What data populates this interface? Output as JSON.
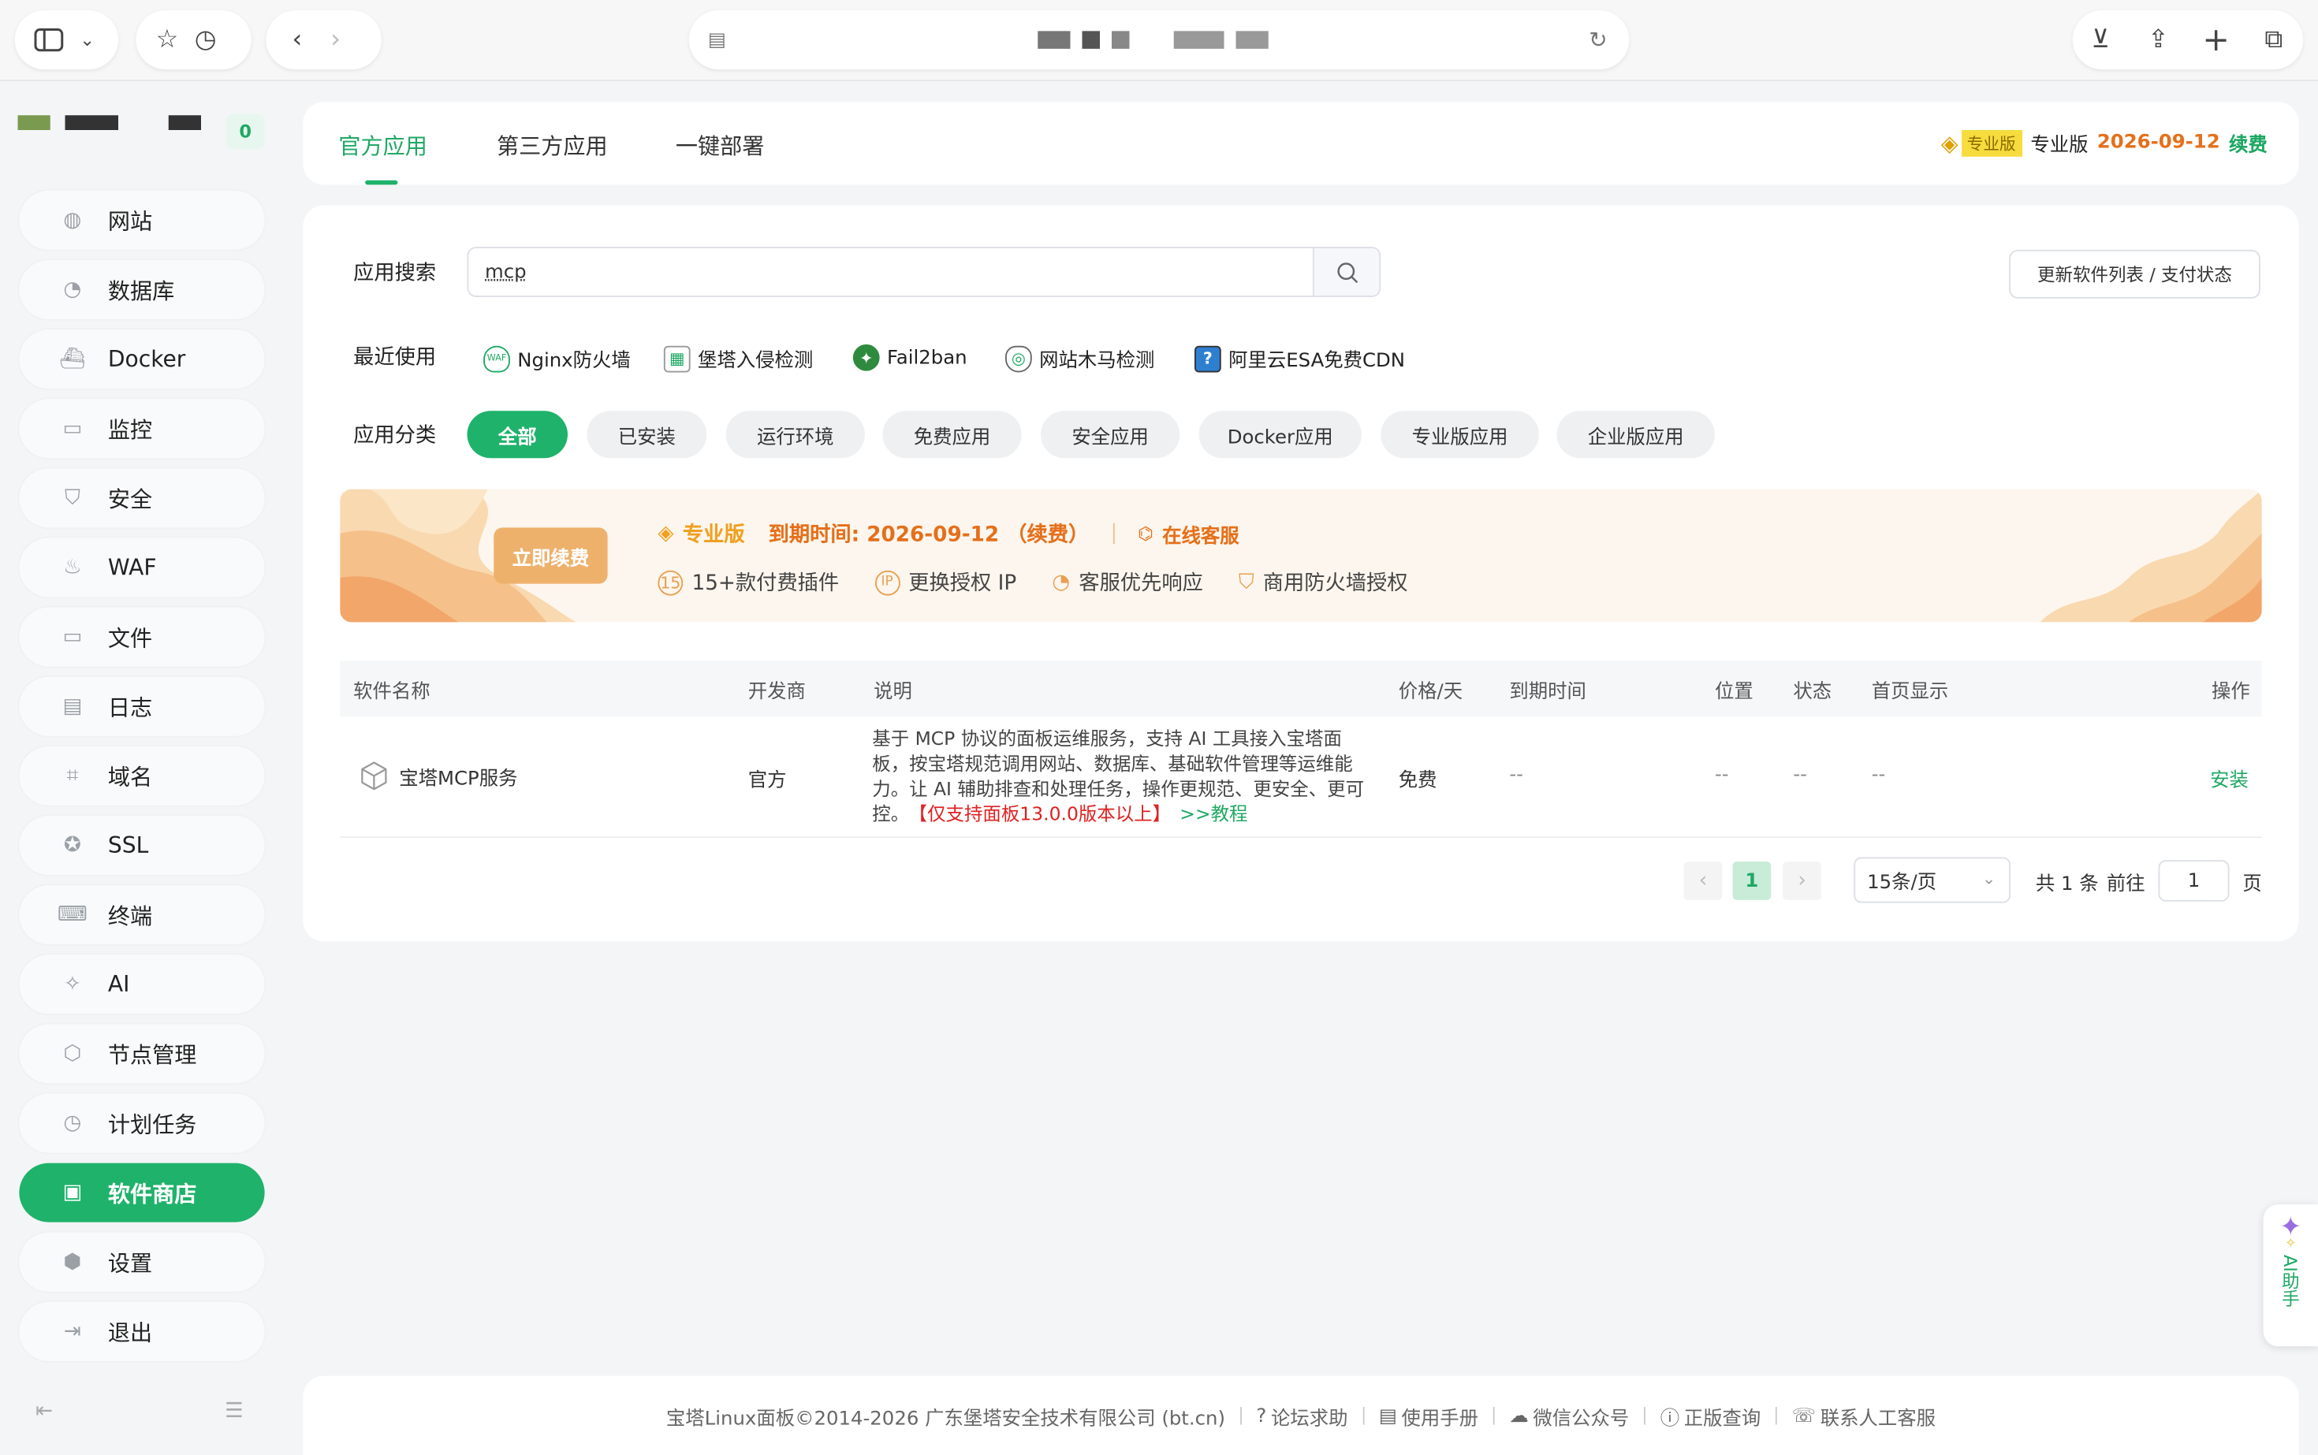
{
  "browser": {
    "address_masked": "■ ■ ■ ■■■ ■"
  },
  "sidebar": {
    "badge": "0",
    "items": [
      {
        "label": "网站",
        "icon": "globe-icon"
      },
      {
        "label": "数据库",
        "icon": "database-icon"
      },
      {
        "label": "Docker",
        "icon": "docker-icon"
      },
      {
        "label": "监控",
        "icon": "monitor-icon"
      },
      {
        "label": "安全",
        "icon": "shield-icon"
      },
      {
        "label": "WAF",
        "icon": "waf-icon"
      },
      {
        "label": "文件",
        "icon": "folder-icon"
      },
      {
        "label": "日志",
        "icon": "log-icon"
      },
      {
        "label": "域名",
        "icon": "domain-icon"
      },
      {
        "label": "SSL",
        "icon": "ssl-icon"
      },
      {
        "label": "终端",
        "icon": "terminal-icon"
      },
      {
        "label": "AI",
        "icon": "ai-sparkle-icon"
      },
      {
        "label": "节点管理",
        "icon": "cube-icon"
      },
      {
        "label": "计划任务",
        "icon": "clock-icon"
      },
      {
        "label": "软件商店",
        "icon": "store-icon",
        "active": true
      },
      {
        "label": "设置",
        "icon": "settings-icon"
      },
      {
        "label": "退出",
        "icon": "logout-icon"
      }
    ]
  },
  "tabs": [
    "官方应用",
    "第三方应用",
    "一键部署"
  ],
  "license": {
    "badge": "专业版",
    "label": "专业版",
    "date": "2026-09-12",
    "renew": "续费"
  },
  "search": {
    "label": "应用搜索",
    "value": "mcp",
    "update_button": "更新软件列表 / 支付状态"
  },
  "recent": {
    "label": "最近使用",
    "items": [
      "Nginx防火墙",
      "堡塔入侵检测",
      "Fail2ban",
      "网站木马检测",
      "阿里云ESA免费CDN"
    ]
  },
  "category": {
    "label": "应用分类",
    "chips": [
      "全部",
      "已安装",
      "运行环境",
      "免费应用",
      "安全应用",
      "Docker应用",
      "专业版应用",
      "企业版应用"
    ]
  },
  "banner": {
    "renew_button": "立即续费",
    "edition": "专业版",
    "expire": "到期时间: 2026-09-12 （续费）",
    "service": "在线客服",
    "features": [
      "15+款付费插件",
      "更换授权 IP",
      "客服优先响应",
      "商用防火墙授权"
    ]
  },
  "table": {
    "headers": [
      "软件名称",
      "开发商",
      "说明",
      "价格/天",
      "到期时间",
      "位置",
      "状态",
      "首页显示",
      "操作"
    ],
    "rows": [
      {
        "name": "宝塔MCP服务",
        "vendor": "官方",
        "desc": "基于 MCP 协议的面板运维服务，支持 AI 工具接入宝塔面板，按宝塔规范调用网站、数据库、基础软件管理等运维能力。让 AI 辅助排查和处理任务，操作更规范、更安全、更可控。",
        "desc_warn": "【仅支持面板13.0.0版本以上】",
        "desc_link": ">>教程",
        "price": "免费",
        "expire": "--",
        "location": "--",
        "status": "--",
        "home": "--",
        "action": "安装"
      }
    ]
  },
  "pagination": {
    "current": "1",
    "per_page": "15条/页",
    "total": "共 1 条",
    "goto_label": "前往",
    "goto_value": "1",
    "page_unit": "页"
  },
  "ai_helper": "AI助手",
  "footer": {
    "copyright": "宝塔Linux面板©2014-2026 广东堡塔安全技术有限公司 (bt.cn)",
    "links": [
      "论坛求助",
      "使用手册",
      "微信公众号",
      "正版查询",
      "联系人工客服"
    ]
  },
  "colors": {
    "accent": "#1fb26b",
    "warn": "#e5701b",
    "danger": "#e02020"
  }
}
